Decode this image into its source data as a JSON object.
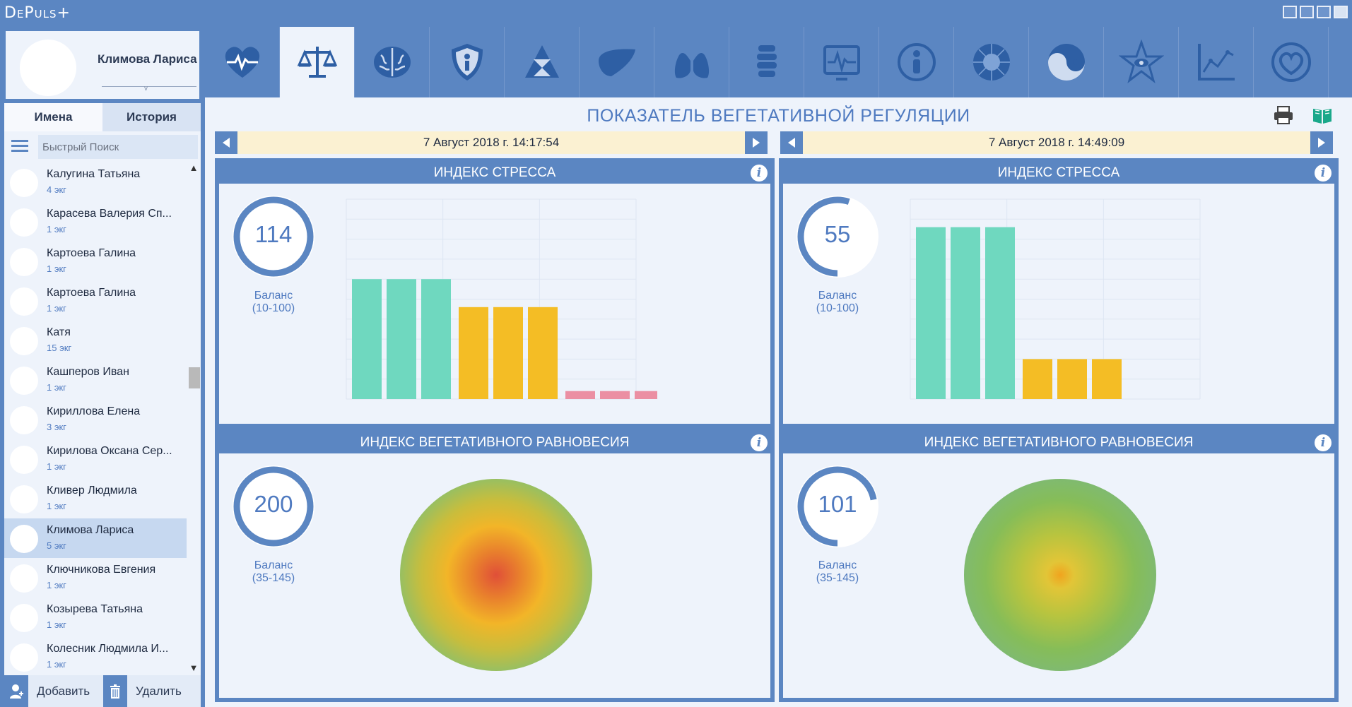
{
  "app": {
    "title": "DePuls+"
  },
  "profile": {
    "name": "Климова Лариса"
  },
  "tabs": {
    "names": "Имена",
    "history": "История"
  },
  "search": {
    "placeholder": "Быстрый Поиск"
  },
  "patients": [
    {
      "name": "Калугина Татьяна",
      "count": "4 экг"
    },
    {
      "name": "Карасева Валерия Сп...",
      "count": "1 экг"
    },
    {
      "name": "Картоева Галина",
      "count": "1 экг"
    },
    {
      "name": "Картоева Галина",
      "count": "1 экг"
    },
    {
      "name": "Катя",
      "count": "15 экг"
    },
    {
      "name": "Кашперов Иван",
      "count": "1 экг"
    },
    {
      "name": "Кириллова Елена",
      "count": "3 экг"
    },
    {
      "name": "Кирилова Оксана Сер...",
      "count": "1 экг"
    },
    {
      "name": "Кливер Людмила",
      "count": "1 экг"
    },
    {
      "name": "Климова Лариса",
      "count": "5 экг",
      "selected": true
    },
    {
      "name": "Ключникова Евгения",
      "count": "1 экг"
    },
    {
      "name": "Козырева Татьяна",
      "count": "1 экг"
    },
    {
      "name": "Колесник Людмила И...",
      "count": "1 экг"
    }
  ],
  "bottom": {
    "add": "Добавить",
    "delete": "Удалить"
  },
  "toolbar": {
    "icons": [
      "heart-pulse-icon",
      "scales-icon",
      "brain-icon",
      "shield-person-icon",
      "hourglass-pyramid-icon",
      "liver-icon",
      "lungs-icon",
      "spine-icon",
      "ecg-monitor-icon",
      "person-circle-icon",
      "sun-burst-icon",
      "yin-yang-icon",
      "star-eye-icon",
      "line-chart-icon",
      "heart-ring-icon"
    ],
    "active_index": 1
  },
  "page": {
    "title": "ПОКАЗАТЕЛЬ ВЕГЕТАТИВНОЙ РЕГУЛЯЦИИ"
  },
  "sessions": [
    {
      "date": "7 Август 2018 г. 14:17:54",
      "stress": {
        "title": "ИНДЕКС СТРЕССА",
        "value": "114",
        "gauge_fraction": 1.0,
        "caption": "Баланс\n(10-100)",
        "bars": [
          0.6,
          0.6,
          0.6,
          0.46,
          0.46,
          0.46,
          0.04,
          0.04,
          0.04
        ]
      },
      "balance": {
        "title": "ИНДЕКС ВЕГЕТАТИВНОГО РАВНОВЕСИЯ",
        "value": "200",
        "gauge_fraction": 1.0,
        "caption": "Баланс\n(35-145)",
        "center": "red"
      }
    },
    {
      "date": "7 Август 2018 г. 14:49:09",
      "stress": {
        "title": "ИНДЕКС СТРЕССА",
        "value": "55",
        "gauge_fraction": 0.55,
        "caption": "Баланс\n(10-100)",
        "bars": [
          0.86,
          0.86,
          0.86,
          0.2,
          0.2,
          0.2
        ]
      },
      "balance": {
        "title": "ИНДЕКС ВЕГЕТАТИВНОГО РАВНОВЕСИЯ",
        "value": "101",
        "gauge_fraction": 0.72,
        "caption": "Баланс\n(35-145)",
        "center": "yellow"
      }
    }
  ],
  "colors": {
    "accent": "#5b86c2",
    "bar_green": "#6fd8bf",
    "bar_yellow": "#f4bd25",
    "bar_pink": "#eb8fa3"
  }
}
